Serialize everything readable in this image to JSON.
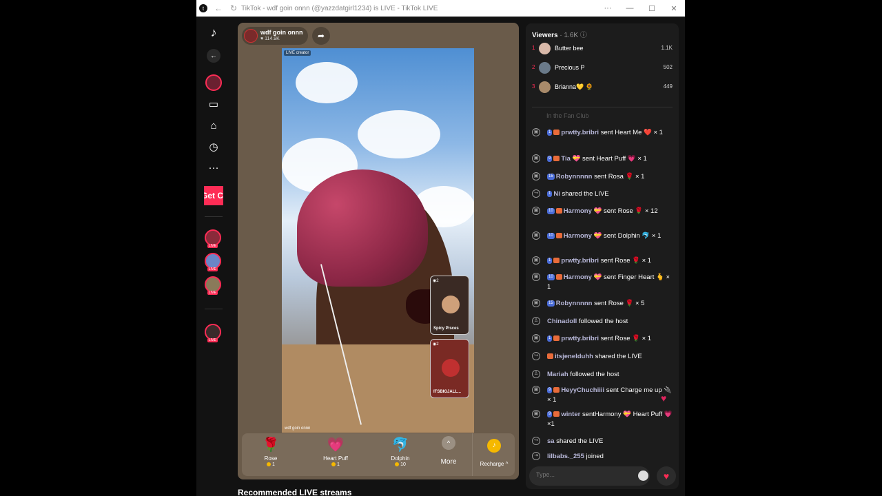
{
  "window": {
    "title": "TikTok - wdf goin onnn (@yazzdatgirl1234) is LIVE - TikTok LIVE",
    "logo": "t"
  },
  "sidebar": {
    "get_button": "Get C",
    "icons": [
      "tiktok-logo",
      "back-arrow",
      "user",
      "camera",
      "explore",
      "history",
      "more"
    ]
  },
  "stream": {
    "host_name": "wdf goin onnn",
    "likes": "114.9K",
    "live_tag": "LIVE creator",
    "watermark": "wdf goin onnn",
    "guests": [
      {
        "name": "Spicy Pisces",
        "count": "2"
      },
      {
        "name": "ITSBIGJALL...",
        "count": "2"
      }
    ]
  },
  "gifts": [
    {
      "name": "Rose",
      "price": "1",
      "icon": "🌹"
    },
    {
      "name": "Heart Puff",
      "price": "1",
      "icon": "💗"
    },
    {
      "name": "Dolphin",
      "price": "10",
      "icon": "🐬"
    }
  ],
  "gift_bar": {
    "more": "More",
    "recharge": "Recharge ^"
  },
  "recommended": "Recommended LIVE streams",
  "viewers": {
    "label": "Viewers",
    "count": "· 1.6K",
    "top": [
      {
        "rank": "1",
        "name": "Butter bee",
        "score": "1.1K"
      },
      {
        "rank": "2",
        "name": "Precious P",
        "score": "502"
      },
      {
        "rank": "3",
        "name": "Brianna💛 🌻",
        "score": "449"
      }
    ]
  },
  "fan_club": "In the Fan Club",
  "chat": [
    {
      "icon": "gift",
      "lvl": "1",
      "fan": true,
      "user": "prwtty.bribri",
      "text": " sent Heart Me ❤️ × 1"
    },
    {
      "icon": "gift",
      "lvl": "9",
      "fan": true,
      "user": "Tia 💝",
      "text": " sent Heart Puff 💗 × 1"
    },
    {
      "icon": "gift",
      "lvl": "15",
      "fan": false,
      "user": "Robynnnnn",
      "text": " sent Rosa 🌹 × 1"
    },
    {
      "icon": "share",
      "lvl": "1",
      "fan": false,
      "user": "Ni",
      "text": " shared the LIVE"
    },
    {
      "icon": "gift",
      "lvl": "10",
      "fan": true,
      "user": "Harmony 💝",
      "text": " sent Rose 🌹 × 12"
    },
    {
      "icon": "gift",
      "lvl": "10",
      "fan": true,
      "user": "Harmony 💝",
      "text": " sent Dolphin 🐬 × 1"
    },
    {
      "icon": "gift",
      "lvl": "1",
      "fan": true,
      "user": "prwtty.bribri",
      "text": " sent Rose 🌹 × 1"
    },
    {
      "icon": "gift",
      "lvl": "10",
      "fan": true,
      "user": "Harmony 💝",
      "text": " sent Finger Heart 🫰 × 1"
    },
    {
      "icon": "gift",
      "lvl": "15",
      "fan": false,
      "user": "Robynnnnn",
      "text": " sent Rose 🌹 × 5"
    },
    {
      "icon": "follow",
      "lvl": "",
      "fan": false,
      "user": "Chinadoll",
      "text": " followed the host"
    },
    {
      "icon": "gift",
      "lvl": "1",
      "fan": true,
      "user": "prwtty.bribri",
      "text": " sent Rose 🌹 × 1"
    },
    {
      "icon": "share",
      "lvl": "",
      "fan": true,
      "user": "itsjenelduhh",
      "text": " shared the LIVE"
    },
    {
      "icon": "follow",
      "lvl": "",
      "fan": false,
      "user": "Mariah",
      "text": " followed the host"
    },
    {
      "icon": "gift",
      "lvl": "9",
      "fan": true,
      "user": "HeyyChuchiiii",
      "text": " sent Charge me up 🔌 × 1"
    },
    {
      "icon": "gift",
      "lvl": "9",
      "fan": true,
      "user": "winter",
      "text": " sentHarmony 💝 Heart Puff 💗 ×1"
    },
    {
      "icon": "share",
      "lvl": "",
      "fan": false,
      "user": "sa",
      "text": " shared the LIVE"
    },
    {
      "icon": "join",
      "lvl": "",
      "fan": false,
      "user": "lilbabs._255",
      "text": " joined"
    }
  ],
  "input": {
    "placeholder": "Type..."
  }
}
